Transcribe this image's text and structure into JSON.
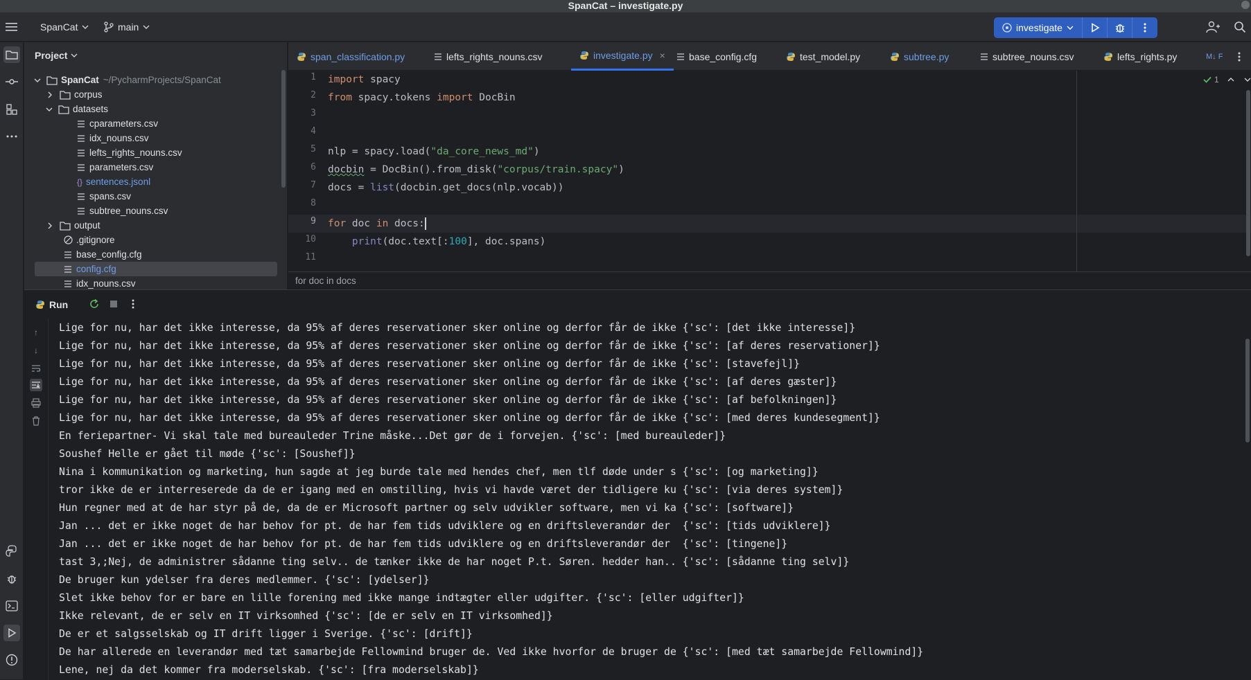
{
  "window": {
    "title": "SpanCat – investigate.py"
  },
  "toolbar": {
    "project_name": "SpanCat",
    "branch": "main",
    "run_config": "investigate"
  },
  "project_panel": {
    "title": "Project",
    "root": {
      "name": "SpanCat",
      "path": "~/PycharmProjects/SpanCat"
    },
    "items": [
      {
        "label": "corpus",
        "kind": "folder",
        "expanded": false
      },
      {
        "label": "datasets",
        "kind": "folder",
        "expanded": true
      },
      {
        "label": "cparameters.csv",
        "kind": "file"
      },
      {
        "label": "idx_nouns.csv",
        "kind": "file"
      },
      {
        "label": "lefts_rights_nouns.csv",
        "kind": "file"
      },
      {
        "label": "parameters.csv",
        "kind": "file"
      },
      {
        "label": "sentences.jsonl",
        "kind": "json"
      },
      {
        "label": "spans.csv",
        "kind": "file"
      },
      {
        "label": "subtree_nouns.csv",
        "kind": "file"
      },
      {
        "label": "output",
        "kind": "folder",
        "expanded": false
      },
      {
        "label": ".gitignore",
        "kind": "ignore"
      },
      {
        "label": "base_config.cfg",
        "kind": "file"
      },
      {
        "label": "config.cfg",
        "kind": "file",
        "selected": true
      },
      {
        "label": "idx_nouns.csv",
        "kind": "file"
      }
    ]
  },
  "tabs": [
    {
      "label": "span_classification.py",
      "type": "python",
      "modified": true
    },
    {
      "label": "lefts_rights_nouns.csv",
      "type": "text"
    },
    {
      "label": "investigate.py",
      "type": "python",
      "active": true,
      "close": "×"
    },
    {
      "label": "base_config.cfg",
      "type": "text"
    },
    {
      "label": "test_model.py",
      "type": "python"
    },
    {
      "label": "subtree.py",
      "type": "python",
      "modified": true
    },
    {
      "label": "subtree_nouns.csv",
      "type": "text"
    },
    {
      "label": "lefts_rights.py",
      "type": "python"
    },
    {
      "label": "M↓ F",
      "type": "markdown"
    }
  ],
  "editor": {
    "line_numbers": [
      "1",
      "2",
      "3",
      "4",
      "5",
      "6",
      "7",
      "8",
      "9",
      "10",
      "11"
    ],
    "inspection_count": "1",
    "lines": [
      "import spacy",
      "from spacy.tokens import DocBin",
      "",
      "",
      "nlp = spacy.load(\"da_core_news_md\")",
      "docbin = DocBin().from_disk(\"corpus/train.spacy\")",
      "docs = list(docbin.get_docs(nlp.vocab))",
      "",
      "for doc in docs:",
      "    print(doc.text[:100], doc.spans)",
      ""
    ],
    "breadcrumb": "for doc in docs"
  },
  "run_panel": {
    "title": "Run",
    "output": [
      "Lige for nu, har det ikke interesse, da 95% af deres reservationer sker online og derfor får de ikke {'sc': [det ikke interesse]}",
      "Lige for nu, har det ikke interesse, da 95% af deres reservationer sker online og derfor får de ikke {'sc': [af deres reservationer]}",
      "Lige for nu, har det ikke interesse, da 95% af deres reservationer sker online og derfor får de ikke {'sc': [stavefejl]}",
      "Lige for nu, har det ikke interesse, da 95% af deres reservationer sker online og derfor får de ikke {'sc': [af deres gæster]}",
      "Lige for nu, har det ikke interesse, da 95% af deres reservationer sker online og derfor får de ikke {'sc': [af befolkningen]}",
      "Lige for nu, har det ikke interesse, da 95% af deres reservationer sker online og derfor får de ikke {'sc': [med deres kundesegment]}",
      "En feriepartner- Vi skal tale med bureauleder Trine måske...Det gør de i forvejen. {'sc': [med bureauleder]}",
      "Soushef Helle er gået til møde {'sc': [Soushef]}",
      "Nina i kommunikation og marketing, hun sagde at jeg burde tale med hendes chef, men tlf døde under s {'sc': [og marketing]}",
      "tror ikke de er interreserede da de er igang med en omstilling, hvis vi havde været der tidligere ku {'sc': [via deres system]}",
      "Hun regner med at de har styr på de, da de er Microsoft partner og selv udvikler software, men vi ka {'sc': [software]}",
      "Jan ... det er ikke noget de har behov for pt. de har fem tids udviklere og en driftsleverandør der  {'sc': [tids udviklere]}",
      "Jan ... det er ikke noget de har behov for pt. de har fem tids udviklere og en driftsleverandør der  {'sc': [tingene]}",
      "tast 3,;Nej, de administrer sådanne ting selv.. de tænker ikke de har noget P.t. Søren. hedder han.. {'sc': [sådanne ting selv]}",
      "De bruger kun ydelser fra deres medlemmer. {'sc': [ydelser]}",
      "Slet ikke behov for er bare en lille forening med ikke mange indtægter eller udgifter. {'sc': [eller udgifter]}",
      "Ikke relevant, de er selv en IT virksomhed {'sc': [de er selv en IT virksomhed]}",
      "De er et salgsselskab og IT drift ligger i Sverige. {'sc': [drift]}",
      "De har allerede en leverandør med tæt samarbejde Fellowmind bruger de. Ved ikke hvorfor de bruger de {'sc': [med tæt samarbejde Fellowmind]}",
      "Lene, nej da det kommer fra moderselskab. {'sc': [fra moderselskab]}"
    ]
  },
  "colors": {
    "accent": "#3574f0",
    "keyword": "#cf8e6d",
    "string": "#6aab73",
    "number": "#2aacb8",
    "builtin": "#8888c6",
    "python_icon": "#f0c54d"
  }
}
